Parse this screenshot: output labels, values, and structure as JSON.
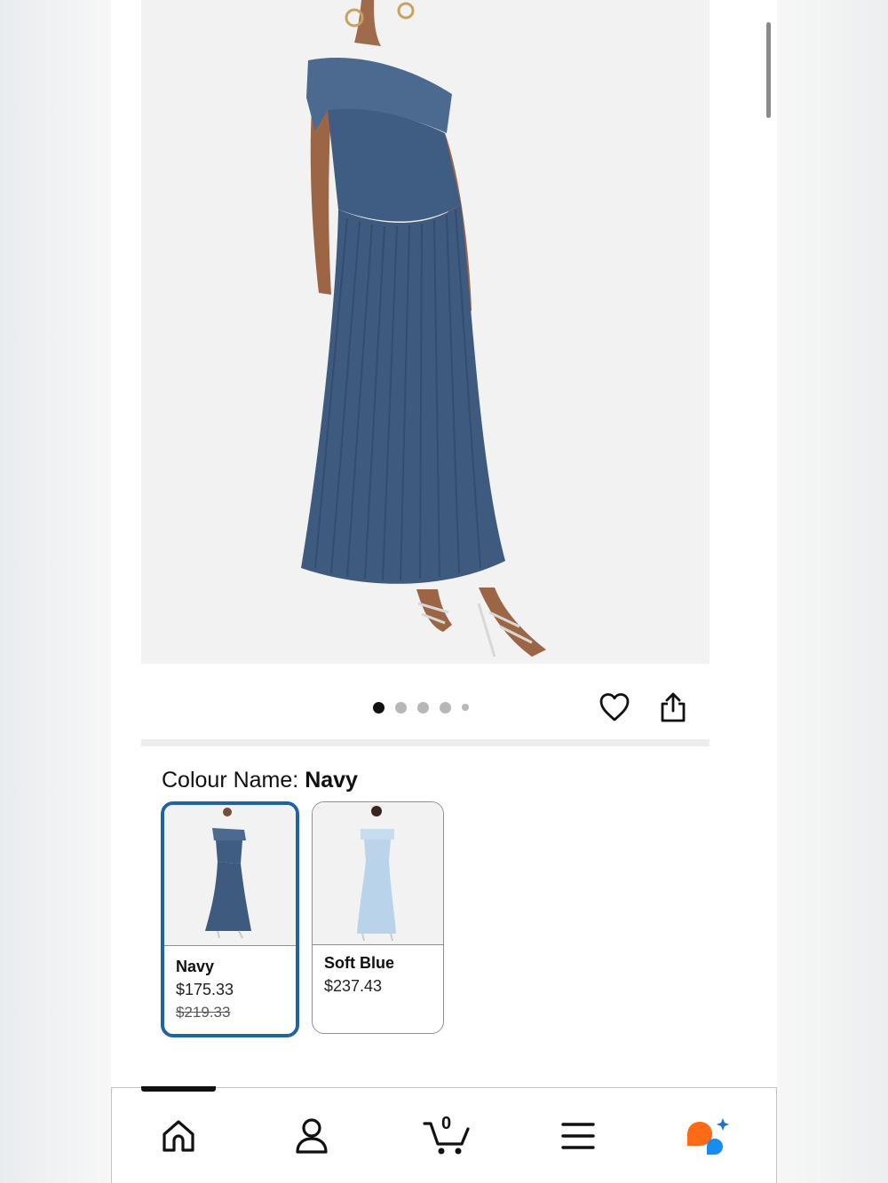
{
  "product": {
    "colour_label": "Colour Name:",
    "selected_colour": "Navy",
    "image_count": 5,
    "current_image": 1
  },
  "swatches": [
    {
      "name": "Navy",
      "price": "$175.33",
      "was_price": "$219.33",
      "selected": true,
      "dress_color": "#3e5a7e"
    },
    {
      "name": "Soft Blue",
      "price": "$237.43",
      "was_price": "",
      "selected": false,
      "dress_color": "#b9d3ea"
    }
  ],
  "bottom_nav": {
    "cart_count": "0",
    "items": [
      "home-icon",
      "account-icon",
      "cart-icon",
      "menu-icon",
      "rufus-assistant-icon"
    ]
  },
  "colors": {
    "selected_border": "#2162a1",
    "navy_dress": "#3e5a7e",
    "assistant_orange": "#ff6a14",
    "assistant_blue": "#1a8cf0"
  }
}
